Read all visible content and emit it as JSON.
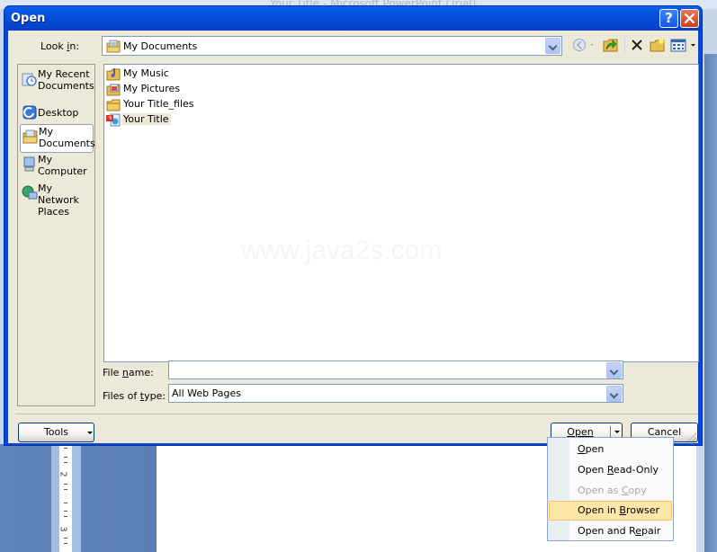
{
  "background": {
    "app_title": "Your Title - Microsoft PowerPoint (Trial)",
    "ruler_numbers": [
      "2",
      "3"
    ]
  },
  "dialog": {
    "title": "Open",
    "help_glyph": "?",
    "close_glyph": "✕",
    "look_in_label": "Look in:",
    "look_in_value": "My Documents",
    "toolbar": [
      {
        "name": "back-icon"
      },
      {
        "name": "up-one-level-icon"
      },
      {
        "name": "delete-icon"
      },
      {
        "name": "new-folder-icon"
      },
      {
        "name": "views-icon"
      }
    ],
    "places": [
      {
        "label_line1": "My Recent",
        "label_line2": "Documents",
        "icon": "recent-documents-icon",
        "selected": false
      },
      {
        "label_line1": "Desktop",
        "label_line2": "",
        "icon": "desktop-icon",
        "selected": false
      },
      {
        "label_line1": "My",
        "label_line2": "Documents",
        "icon": "my-documents-icon",
        "selected": true
      },
      {
        "label_line1": "My",
        "label_line2": "Computer",
        "icon": "my-computer-icon",
        "selected": false
      },
      {
        "label_line1": "My Network",
        "label_line2": "Places",
        "icon": "network-places-icon",
        "selected": false
      }
    ],
    "files": [
      {
        "name": "My Music",
        "icon": "music-folder-icon"
      },
      {
        "name": "My Pictures",
        "icon": "pictures-folder-icon"
      },
      {
        "name": "Your Title_files",
        "icon": "folder-icon"
      },
      {
        "name": "Your Title",
        "icon": "powerpoint-file-icon",
        "highlighted": true
      }
    ],
    "watermark": "www.java2s.com",
    "file_name_label": "File name:",
    "file_name_value": "",
    "files_of_type_label": "Files of type:",
    "files_of_type_value": "All Web Pages",
    "tools_label": "Tools",
    "open_label": "Open",
    "cancel_label": "Cancel"
  },
  "open_menu": {
    "items": [
      {
        "label": "Open",
        "enabled": true,
        "highlighted": false
      },
      {
        "label": "Open Read-Only",
        "enabled": true,
        "highlighted": false
      },
      {
        "label": "Open as Copy",
        "enabled": false,
        "highlighted": false
      },
      {
        "label": "Open in Browser",
        "enabled": true,
        "highlighted": true
      },
      {
        "label": "Open and Repair",
        "enabled": true,
        "highlighted": false
      }
    ]
  },
  "colors": {
    "title_bar": "#0553df",
    "dialog_face": "#ece9d8",
    "menu_highlight": "#fde7a8",
    "menu_highlight_border": "#f3c36a",
    "disabled_text": "#a7a7a7"
  }
}
